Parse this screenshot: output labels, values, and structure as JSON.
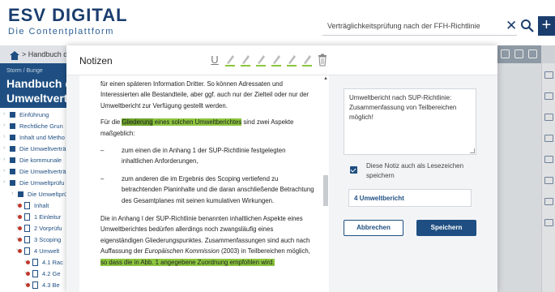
{
  "app": {
    "logo_main": "ES",
    "logo_accent": "V",
    "logo_rest": " DIGITAL",
    "logo_subtitle": "Die Contentplattform",
    "search_value": "Verträglichkeitsprüfung nach der FFH-Richtlinie",
    "crumb": "Handbuch d"
  },
  "sidebar": {
    "kicker": "Storm / Bunge",
    "title_line1": "Handbuch de",
    "title_line2": "Umweltverträ",
    "toc": [
      {
        "label": "Einführung"
      },
      {
        "label": "Rechtliche Grun"
      },
      {
        "label": "Inhalt und Metho"
      },
      {
        "label": "Die Umweltverträ"
      },
      {
        "label": "Die kommunale"
      },
      {
        "label": "Die Umweltverträ"
      },
      {
        "label": "Die Umweltprüfu"
      },
      {
        "label": "Die Umweltprü"
      },
      {
        "label": "Inhalt"
      },
      {
        "label": "1 Einleitur"
      },
      {
        "label": "2 Vorprüfu"
      },
      {
        "label": "3 Scoping"
      },
      {
        "label": "4 Umwelt"
      },
      {
        "label": "4.1 Rac"
      },
      {
        "label": "4.2 Ge"
      },
      {
        "label": "4.3 Be"
      }
    ]
  },
  "modal": {
    "title": "Notizen",
    "doc": {
      "p1": "für einen späteren Information Dritter. So können Adressaten und Interessierten alle Bestandteile, aber ggf. auch nur der Zielteil oder nur der Umweltbericht zur Verfügung gestellt werden.",
      "p2_pre": "Für die ",
      "p2_hl1": "Gliederung",
      "p2_hl2": " eines solchen Umweltberichtes",
      "p2_post": " sind zwei Aspekte maßgeblich:",
      "bullet_dash": "–",
      "b1": "zum einen die in Anhang 1 der SUP-Richtlinie festgelegten inhaltlichen Anforderungen,",
      "b2": "zum anderen die im Ergebnis des Scoping vertiefend zu betrachtenden Planinhalte und die daran anschließende Betrachtung des Gesamtplanes mit seinen kumulativen Wirkungen.",
      "p3_pre": "Die in Anhang I der SUP-Richtlinie benannten inhaltlichen Aspekte eines Umweltberichtes bedürfen allerdings noch zwangsläufig eines eigenständigen Gliederungspunktes. Zusammenfassungen sind auch nach Auffassung der ",
      "p3_em": "Europäischen Kommission",
      "p3_mid": " (2003) in Teilbereichen möglich, ",
      "p3_hl": "so dass die in Abb. 1 angegebene Zuordnung empfohlen wird."
    },
    "note": {
      "text": "Umweltbericht nach SUP-Richtlinie: Zusammenfassung von Teilbereichen möglich!",
      "bookmark_label": "Diese Notiz auch als Lesezeichen speichern",
      "section": "4 Umweltbericht",
      "cancel_label": "Abbrechen",
      "save_label": "Speichern"
    },
    "highlight_colors": [
      "#8dc63f",
      "#8dc63f",
      "#8dc63f",
      "#8dc63f",
      "#8dc63f",
      "#8dc63f"
    ]
  }
}
